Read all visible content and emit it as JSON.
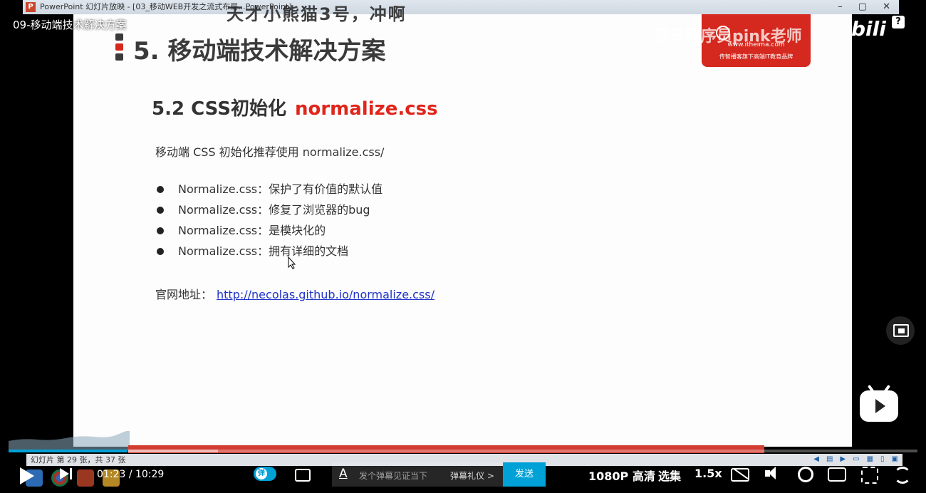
{
  "video": {
    "title": "09-移动端技术解决方案"
  },
  "ppt_window": {
    "title": "PowerPoint 幻灯片放映 - [03_移动WEB开发之流式布局...PowerPoint]",
    "icon_letter": "P",
    "status_text": "幻灯片 第 29 张，共 37 张"
  },
  "slide": {
    "title": "5. 移动端技术解决方案",
    "section_heading": "5.2 CSS初始化",
    "section_accent": "normalize.css",
    "intro": "移动端 CSS 初始化推荐使用 normalize.css/",
    "bullets": [
      "Normalize.css：保护了有价值的默认值",
      "Normalize.css：修复了浏览器的bug",
      "Normalize.css：是模块化的",
      "Normalize.css：拥有详细的文档"
    ],
    "site_label": "官网地址：",
    "site_url": "http://necolas.github.io/normalize.css/",
    "brand_url": "www.itheima.com",
    "brand_sub": "传智播客旗下高端IT教育品牌"
  },
  "overlay": {
    "danmaku": "天才小熊猫3号，冲啊",
    "watermark": "黑马程序员pink老师",
    "bili_logo": "bili"
  },
  "player": {
    "current_time": "01:23",
    "separator": "/",
    "duration": "10:29",
    "progress": 0.13,
    "danmaku_placeholder": "发个弹幕见证当下",
    "danmaku_gift": "弹幕礼仪 >",
    "send_label": "发送",
    "quality": "1080P 高清",
    "episodes": "选集",
    "speed": "1.5x",
    "accent_color": "#00a1d6"
  },
  "icons": {
    "help": "?"
  }
}
